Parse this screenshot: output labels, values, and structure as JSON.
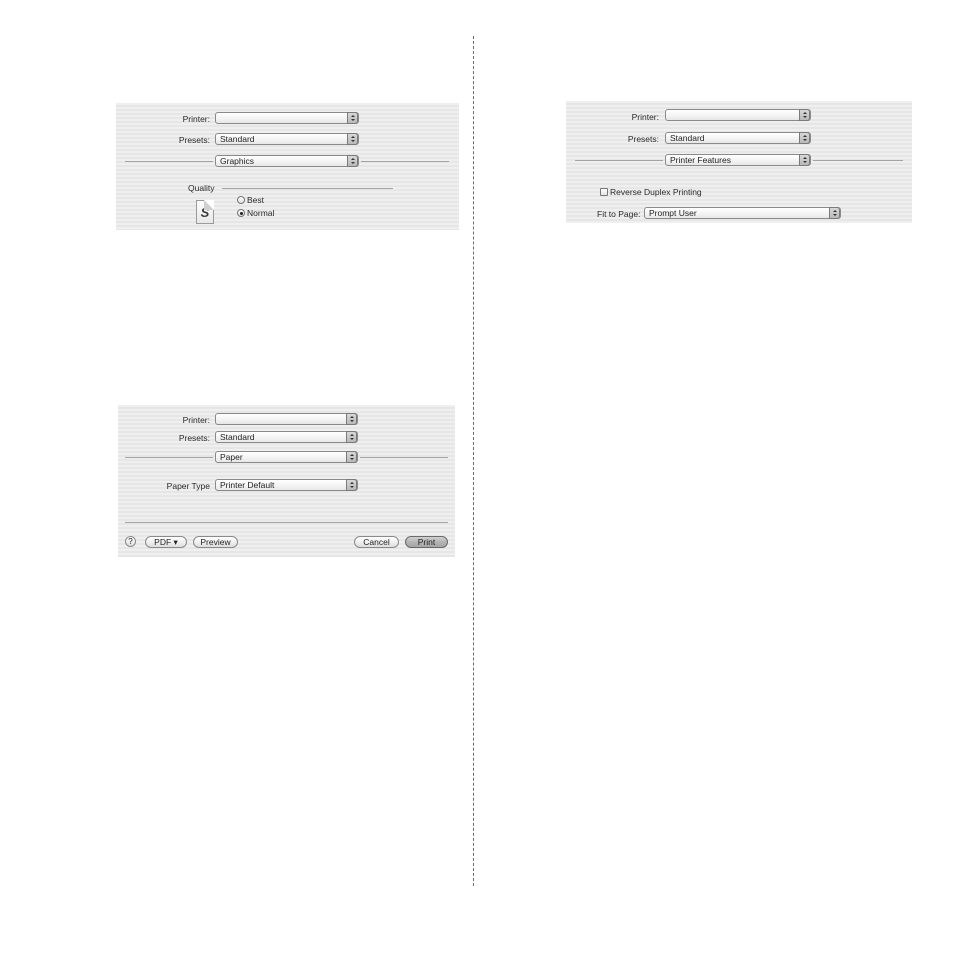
{
  "panels": {
    "graphics": {
      "printer_label": "Printer:",
      "printer_value": "",
      "presets_label": "Presets:",
      "presets_value": "Standard",
      "section_value": "Graphics",
      "quality_label": "Quality",
      "icon": "document-s-icon",
      "quality_options": [
        {
          "label": "Best",
          "selected": false
        },
        {
          "label": "Normal",
          "selected": true
        }
      ]
    },
    "paper": {
      "printer_label": "Printer:",
      "printer_value": "",
      "presets_label": "Presets:",
      "presets_value": "Standard",
      "section_value": "Paper",
      "paper_type_label": "Paper Type",
      "paper_type_value": "Printer Default",
      "buttons": {
        "help": "?",
        "pdf": "PDF ▾",
        "preview": "Preview",
        "cancel": "Cancel",
        "print": "Print"
      }
    },
    "features": {
      "printer_label": "Printer:",
      "printer_value": "",
      "presets_label": "Presets:",
      "presets_value": "Standard",
      "section_value": "Printer Features",
      "reverse_duplex_label": "Reverse Duplex Printing",
      "reverse_duplex_checked": false,
      "fit_to_page_label": "Fit to Page:",
      "fit_to_page_value": "Prompt User"
    }
  }
}
